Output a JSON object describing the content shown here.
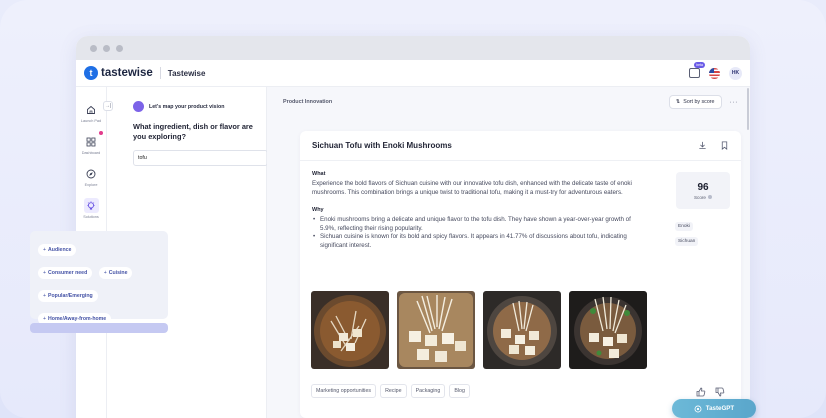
{
  "app": {
    "logo": "tastewise",
    "title": "Tastewise",
    "gpt_badge": "beta",
    "avatar": "HK"
  },
  "nav": [
    {
      "label": "Launch Pad",
      "icon": "home-icon"
    },
    {
      "label": "Dashboard",
      "icon": "dashboard-icon"
    },
    {
      "label": "Explore",
      "icon": "compass-icon"
    },
    {
      "label": "Solutions",
      "icon": "lightbulb-icon"
    }
  ],
  "panel": {
    "vision_text": "Let's map your product vision",
    "question": "What ingredient, dish or flavor are you exploring?",
    "input_value": "tofu",
    "chips": [
      {
        "label": "Audience"
      },
      {
        "label": "Consumer need"
      },
      {
        "label": "Cuisine"
      },
      {
        "label": "Popular/Emerging"
      },
      {
        "label": "Home/Away-from-home"
      }
    ]
  },
  "main": {
    "breadcrumb": "Product Innovation",
    "sort_label": "Sort by score"
  },
  "card": {
    "title": "Sichuan Tofu with Enoki Mushrooms",
    "what_label": "What",
    "what_text": "Experience the bold flavors of Sichuan cuisine with our innovative tofu dish, enhanced with the delicate taste of enoki mushrooms. This combination brings a unique twist to traditional tofu, making it a must-try for adventurous eaters.",
    "why_label": "Why",
    "why_items": [
      "Enoki mushrooms bring a delicate and unique flavor to the tofu dish. They have shown a year-over-year growth of 5.9%, reflecting their rising popularity.",
      "Sichuan cuisine is known for its bold and spicy flavors. It appears in 41.77% of discussions about tofu, indicating significant interest."
    ],
    "score": "96",
    "score_label": "Score",
    "tags": [
      "Enoki",
      "Sichuan"
    ],
    "bottom_tags": [
      "Marketing opportunities",
      "Recipe",
      "Packaging",
      "Blog"
    ]
  },
  "tastegpt_label": "TasteGPT"
}
